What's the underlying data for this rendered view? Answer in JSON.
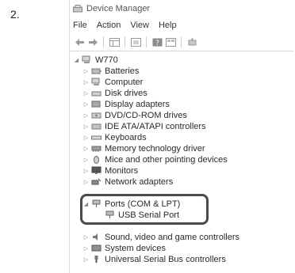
{
  "step": {
    "number": "2."
  },
  "window": {
    "title": "Device Manager",
    "app_icon": "device-manager-icon",
    "menus": [
      {
        "label": "File"
      },
      {
        "label": "Action"
      },
      {
        "label": "View"
      },
      {
        "label": "Help"
      }
    ],
    "toolbar": [
      {
        "icon": "back-arrow-icon"
      },
      {
        "icon": "forward-arrow-icon"
      },
      {
        "icon": "properties-grid-icon"
      },
      {
        "icon": "scan-icon"
      },
      {
        "icon": "help-icon"
      },
      {
        "icon": "view-icon"
      },
      {
        "icon": "hardware-changes-icon"
      }
    ]
  },
  "tree": {
    "root": {
      "label": "W770",
      "icon": "computer-icon",
      "expanded": true
    },
    "nodes": [
      {
        "label": "Batteries",
        "icon": "battery-icon"
      },
      {
        "label": "Computer",
        "icon": "computer-icon"
      },
      {
        "label": "Disk drives",
        "icon": "disk-drive-icon"
      },
      {
        "label": "Display adapters",
        "icon": "display-adapter-icon"
      },
      {
        "label": "DVD/CD-ROM drives",
        "icon": "dvd-drive-icon"
      },
      {
        "label": "IDE ATA/ATAPI controllers",
        "icon": "ide-controller-icon"
      },
      {
        "label": "Keyboards",
        "icon": "keyboard-icon"
      },
      {
        "label": "Memory technology driver",
        "icon": "memory-icon"
      },
      {
        "label": "Mice and other pointing devices",
        "icon": "mouse-icon"
      },
      {
        "label": "Monitors",
        "icon": "monitor-icon"
      },
      {
        "label": "Network adapters",
        "icon": "network-adapter-icon"
      },
      {
        "label": "Ports (COM & LPT)",
        "icon": "port-icon",
        "expanded": true
      },
      {
        "label": "USB Serial Port",
        "icon": "port-icon",
        "child": true
      },
      {
        "label": "Sound, video and game controllers",
        "icon": "sound-icon"
      },
      {
        "label": "System devices",
        "icon": "system-device-icon"
      },
      {
        "label": "Universal Serial Bus controllers",
        "icon": "usb-icon"
      }
    ]
  },
  "colors": {
    "highlight_border": "#4a4a4a",
    "text": "#2a2a2a"
  }
}
